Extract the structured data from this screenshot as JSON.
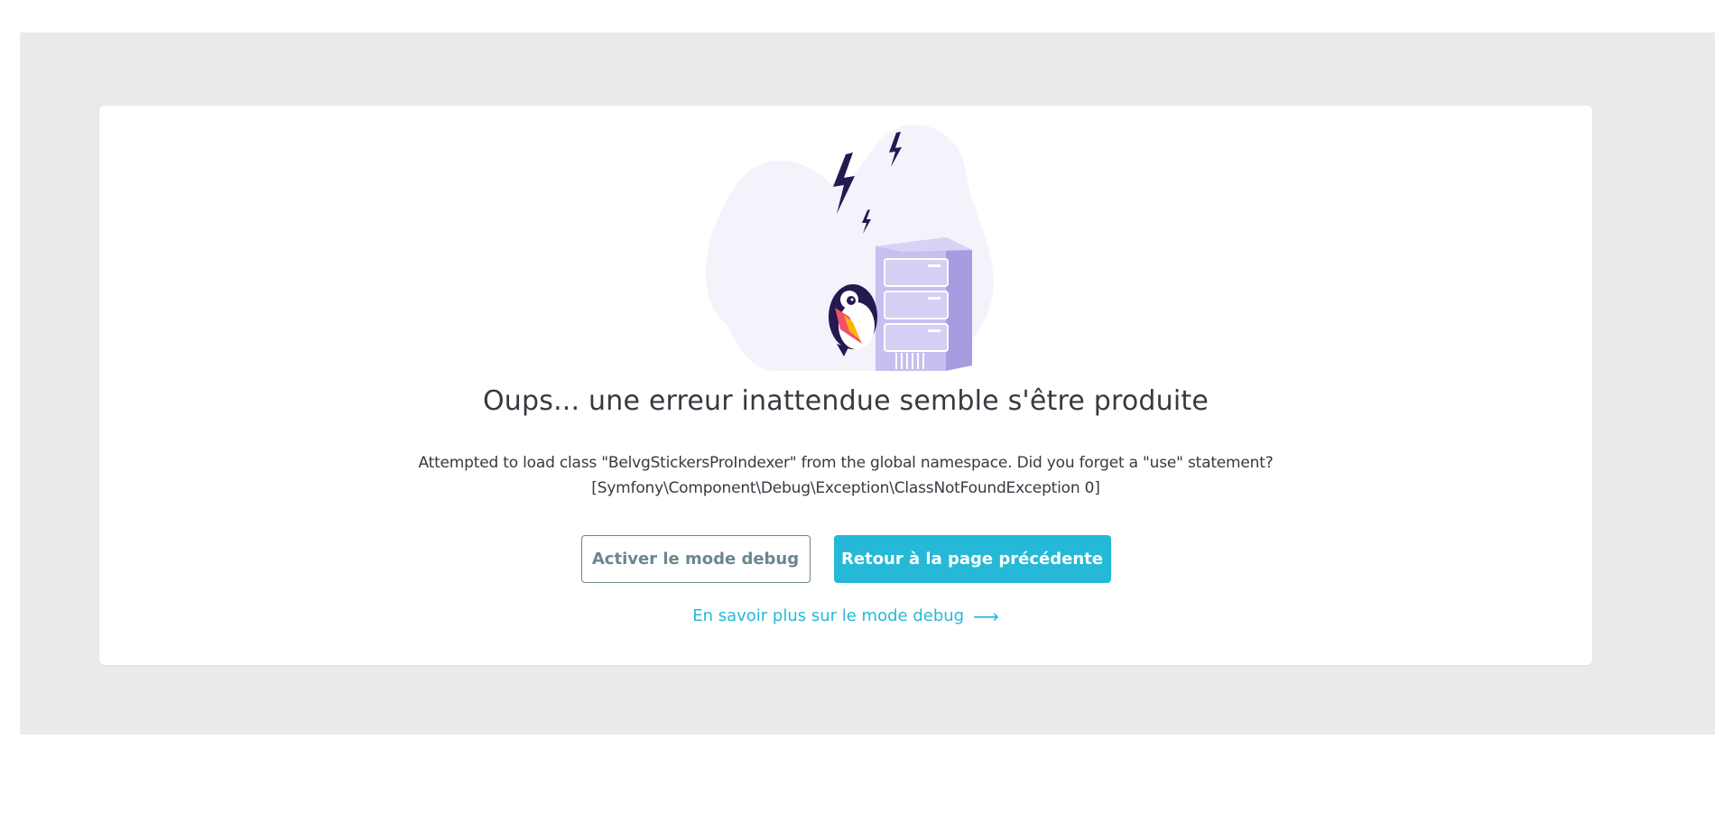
{
  "error": {
    "title": "Oups... une erreur inattendue semble s'être produite",
    "message_line1": "Attempted to load class \"BelvgStickersProIndexer\" from the global namespace. Did you forget a \"use\" statement?",
    "message_line2": "[Symfony\\Component\\Debug\\Exception\\ClassNotFoundException 0]"
  },
  "actions": {
    "debug_button": "Activer le mode debug",
    "back_button": "Retour à la page précédente",
    "learn_more_link": "En savoir plus sur le mode debug",
    "learn_more_arrow": "⟶"
  },
  "colors": {
    "accent": "#25b9d7",
    "outline_button": "#6c868e",
    "text": "#363a41",
    "backdrop": "#e9eaec",
    "illustration_purple": "#bdb1e8",
    "illustration_dark": "#241a4f",
    "blob": "#f4f3fb"
  },
  "icons": {
    "illustration": "server-with-puffin-illustration",
    "arrow": "arrow-right-icon"
  }
}
